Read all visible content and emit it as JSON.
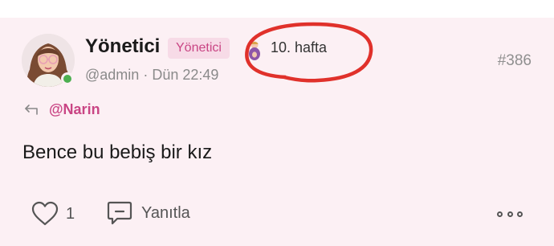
{
  "post": {
    "display_name": "Yönetici",
    "role_badge": "Yönetici",
    "week_label": "10. hafta",
    "handle": "@admin",
    "separator": "·",
    "timestamp": "Dün 22:49",
    "post_number": "#386",
    "reply_to": "@Narin",
    "body": "Bence bu bebiş bir kız",
    "like_count": "1",
    "reply_label": "Yanıtla"
  },
  "icons": {
    "reply_to": "reply-arrow-icon",
    "like": "heart-icon",
    "reply": "speech-bubble-icon",
    "more": "more-dots-icon",
    "week": "baby-icon"
  },
  "colors": {
    "card_background": "#fcf0f4",
    "accent": "#c94584",
    "badge_background": "#f7dbe7",
    "online": "#4caf50",
    "annotation": "#e0312b"
  }
}
